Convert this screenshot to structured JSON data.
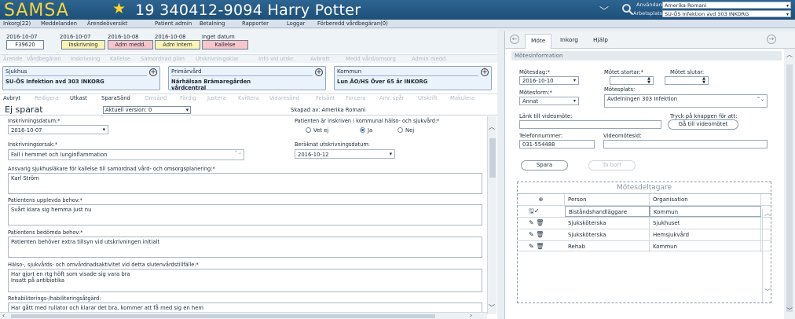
{
  "app": {
    "brand": "SAMSA",
    "patient": "19 340412-9094 Harry Potter",
    "user_label": "Användare:",
    "user_value": "Amerika Romani",
    "workplace_label": "Arbetsplats:",
    "workplace_value": "SU-ÖS Infektion avd 303 INKORG"
  },
  "menu": [
    "Inkorg(22)",
    "Meddelanden",
    "Ärendeöversikt",
    "Patient admin",
    "Betalning",
    "Rapporter",
    "Loggar",
    "Förberedd vårdbegäran(0)"
  ],
  "timeline": {
    "dates": [
      "2016-10-07",
      "2016-10-07",
      "2016-10-08",
      "2016-10-08",
      "Inget datum"
    ],
    "case_id": "F39620",
    "steps": [
      "Inskrivning",
      "Adm medd.",
      "Adm intern",
      "Kallelse"
    ],
    "colors": {
      "yellow": "#fdf3b5",
      "pink": "#f7c6cb",
      "white": "#ffffff"
    }
  },
  "action_row1": [
    "Ärende",
    "Vårdbegäran",
    "Inskrivning",
    "Kallelse",
    "Samordnad plan",
    "Utskrivningsklar",
    "Info vid utskr.",
    "Avbrott",
    "Medd vård/omsorg",
    "Admin medd."
  ],
  "cards": [
    {
      "title": "Sjukhus",
      "value": "SU-ÖS Infektion avd 303 INKORG"
    },
    {
      "title": "Primärvård",
      "value": "Närhälsan Brämaregården vårdcentral"
    },
    {
      "title": "Kommun",
      "value": "Lun ÄO/HS Över 65 år INKORG"
    }
  ],
  "action_row2": [
    "Avbryt",
    "Redigera",
    "Utkast",
    "SparaSänd",
    "Omsänd",
    "Färdig",
    "Justera",
    "Kvittera",
    "Vidaresänd",
    "Felsänt",
    "Forcera",
    "Anv. spår",
    "Utskrift",
    "Makulera"
  ],
  "doc": {
    "title": "Ej sparat",
    "version": "Aktuell version: 0",
    "created_by": "Skapad av: Amerika Romani"
  },
  "form": {
    "inskrivningsdatum_label": "Inskrivningsdatum:*",
    "inskrivningsdatum": "2016-10-07",
    "kommun_question": "Patienten är inskriven i kommunal hälso- och sjukvård:*",
    "radio_options": [
      "Vet ej",
      "Ja",
      "Nej"
    ],
    "radio_selected": "Ja",
    "orsak_label": "Inskrivningsorsak:*",
    "orsak": "Fall i hemmet och lunginflammation",
    "beraknat_label": "Beräknat utskrivningsdatum:",
    "beraknat": "2016-10-12",
    "ansvarig_label": "Ansvarig sjukhusläkare för kallelse till samordnad vård- och omsorgsplanering:*",
    "ansvarig": "Karl Ström",
    "upplevda_label": "Patientens upplevda behov:*",
    "upplevda": "Svårt klara sig hemma just nu",
    "bedomda_label": "Patientens bedömda behov:*",
    "bedomda": "Patienten behöver extra tillsyn vid utskrivningen initialt",
    "halso_label": "Hälso-, sjukvårds- och omvårdnadsaktivitet vid detta slutenvårdstillfälle:*",
    "halso_1": "Har gjort en rtg höft som visade sig vara bra",
    "halso_2": "Insatt på antibiotika",
    "rehab_label": "Rehabiliterings-/habiliteringsåtgärd:",
    "rehab": "Har gått med rullator och klarar det bra, kommer att få med sig en hem"
  },
  "right": {
    "tabs": [
      "Möte",
      "Inkorg",
      "Hjälp"
    ],
    "section": "Mötesinformation",
    "motesdag_label": "Mötesdag:*",
    "motesdag": "2016-10-10",
    "startar_label": "Mötet startar:*",
    "slutar_label": "Mötet slutar:",
    "moteform_label": "Mötesform:*",
    "moteform": "Annat",
    "motesplats_label": "Mötesplats:",
    "motesplats": "Avdelningen 303 Infektion",
    "lank_label": "Länk till videomöte:",
    "tryck_label": "Tryck på knappen för att:",
    "ga_till_button": "Gå till videomötet",
    "telefon_label": "Telefonnummer:",
    "telefon": "031-554488",
    "videomotesid_label": "Videomötesid:",
    "spara_button": "Spara",
    "ta_bort_button": "Ta bort",
    "participants_title": "Mötesdeltagare",
    "col_person": "Person",
    "col_org": "Organisation",
    "participants": [
      {
        "person": "Biståndshandläggare",
        "org": "Kommun"
      },
      {
        "person": "Sjuksköterska",
        "org": "Sjukhuset"
      },
      {
        "person": "Sjuksköterska",
        "org": "Hemsjukvård"
      },
      {
        "person": "Rehab",
        "org": "Kommun"
      }
    ]
  }
}
